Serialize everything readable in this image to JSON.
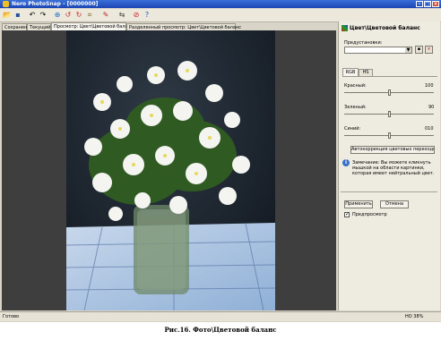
{
  "window": {
    "title": "Nero PhotoSnap - [0000000]"
  },
  "tabs": [
    {
      "label": "Сохранен"
    },
    {
      "label": "Текущий"
    },
    {
      "label": "Просмотр: Цвет\\Цветовой баланс"
    },
    {
      "label": "Разделенный просмотр: Цвет\\Цветовой баланс"
    }
  ],
  "panel": {
    "title": "Цвет\\Цветовой баланс",
    "presets_label": "Предустановки:",
    "subtabs": [
      "RGB",
      "HS"
    ],
    "sliders": [
      {
        "label": "Красный:",
        "value": "100",
        "level": 0.5
      },
      {
        "label": "Зеленый:",
        "value": "90",
        "level": 0.5
      },
      {
        "label": "Синий:",
        "value": "010",
        "level": 0.5
      }
    ],
    "auto_button": "Автокоррекция цветовых переходов",
    "hint": "Замечание: Вы можете кликнуть мышкой на области картинки, которая имеет нейтральный цвет.",
    "apply_button": "Применить",
    "cancel_button": "Отмена",
    "preview_label": "Предпросмотр",
    "preview_checked": true
  },
  "status": {
    "left": "Готово",
    "right": "НО 38%"
  },
  "caption": "Рис.16. Фото\\Цветовой баланс"
}
